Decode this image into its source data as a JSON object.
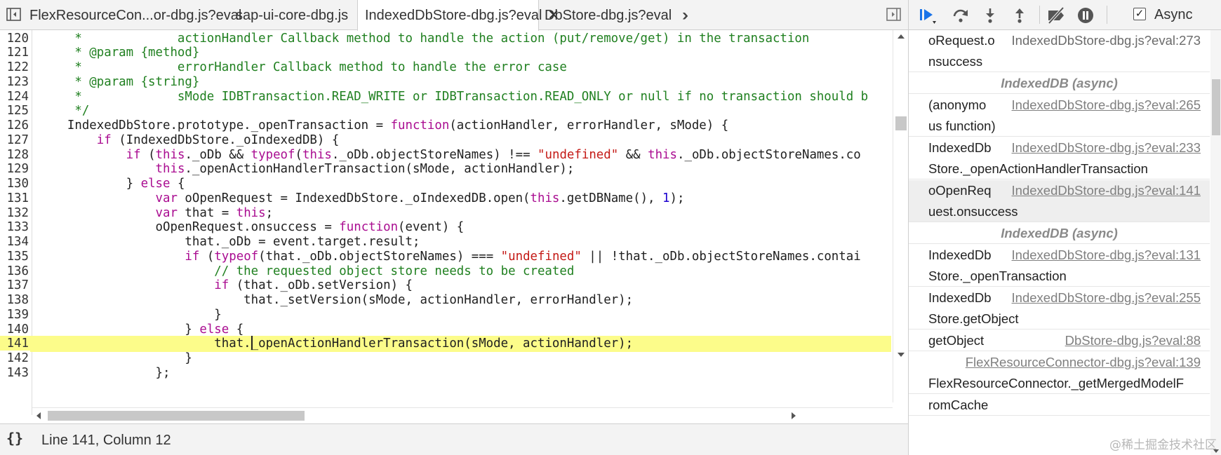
{
  "tabs": [
    {
      "label": "FlexResourceCon...or-dbg.js?eval"
    },
    {
      "label": "sap-ui-core-dbg.js"
    },
    {
      "label": "IndexedDbStore-dbg.js?eval",
      "close": "✕"
    },
    {
      "label": "DbStore-dbg.js?eval"
    }
  ],
  "editor": {
    "lines": [
      {
        "n": "120",
        "code": [
          [
            "c",
            "     *             actionHandler Callback method to handle the action (put/remove/get) in the transaction"
          ]
        ]
      },
      {
        "n": "121",
        "code": [
          [
            "c",
            "     * @param {method}"
          ]
        ]
      },
      {
        "n": "122",
        "code": [
          [
            "c",
            "     *             errorHandler Callback method to handle the error case"
          ]
        ]
      },
      {
        "n": "123",
        "code": [
          [
            "c",
            "     * @param {string}"
          ]
        ]
      },
      {
        "n": "124",
        "code": [
          [
            "c",
            "     *             sMode IDBTransaction.READ_WRITE or IDBTransaction.READ_ONLY or null if no transaction should b"
          ]
        ]
      },
      {
        "n": "125",
        "code": [
          [
            "c",
            "     */"
          ]
        ]
      },
      {
        "n": "126",
        "code": [
          [
            "p",
            "    IndexedDbStore.prototype._openTransaction = "
          ],
          [
            "k",
            "function"
          ],
          [
            "p",
            "(actionHandler, errorHandler, sMode) {"
          ]
        ]
      },
      {
        "n": "127",
        "code": [
          [
            "p",
            "        "
          ],
          [
            "k",
            "if"
          ],
          [
            "p",
            " (IndexedDbStore._oIndexedDB) {"
          ]
        ]
      },
      {
        "n": "128",
        "code": [
          [
            "p",
            "            "
          ],
          [
            "k",
            "if"
          ],
          [
            "p",
            " ("
          ],
          [
            "k",
            "this"
          ],
          [
            "p",
            "._oDb && "
          ],
          [
            "k",
            "typeof"
          ],
          [
            "p",
            "("
          ],
          [
            "k",
            "this"
          ],
          [
            "p",
            "._oDb.objectStoreNames) !== "
          ],
          [
            "s",
            "\"undefined\""
          ],
          [
            "p",
            " && "
          ],
          [
            "k",
            "this"
          ],
          [
            "p",
            "._oDb.objectStoreNames.co"
          ]
        ]
      },
      {
        "n": "129",
        "code": [
          [
            "p",
            "                "
          ],
          [
            "k",
            "this"
          ],
          [
            "p",
            "._openActionHandlerTransaction(sMode, actionHandler);"
          ]
        ]
      },
      {
        "n": "130",
        "code": [
          [
            "p",
            "            } "
          ],
          [
            "k",
            "else"
          ],
          [
            "p",
            " {"
          ]
        ]
      },
      {
        "n": "131",
        "code": [
          [
            "p",
            "                "
          ],
          [
            "k",
            "var"
          ],
          [
            "p",
            " oOpenRequest = IndexedDbStore._oIndexedDB.open("
          ],
          [
            "k",
            "this"
          ],
          [
            "p",
            ".getDBName(), "
          ],
          [
            "n",
            "1"
          ],
          [
            "p",
            ");"
          ]
        ]
      },
      {
        "n": "132",
        "code": [
          [
            "p",
            "                "
          ],
          [
            "k",
            "var"
          ],
          [
            "p",
            " that = "
          ],
          [
            "k",
            "this"
          ],
          [
            "p",
            ";"
          ]
        ]
      },
      {
        "n": "133",
        "code": [
          [
            "p",
            "                oOpenRequest.onsuccess = "
          ],
          [
            "k",
            "function"
          ],
          [
            "p",
            "(event) {"
          ]
        ]
      },
      {
        "n": "134",
        "code": [
          [
            "p",
            "                    that._oDb = event.target.result;"
          ]
        ]
      },
      {
        "n": "135",
        "code": [
          [
            "p",
            "                    "
          ],
          [
            "k",
            "if"
          ],
          [
            "p",
            " ("
          ],
          [
            "k",
            "typeof"
          ],
          [
            "p",
            "(that._oDb.objectStoreNames) === "
          ],
          [
            "s",
            "\"undefined\""
          ],
          [
            "p",
            " || !that._oDb.objectStoreNames.contai"
          ]
        ]
      },
      {
        "n": "136",
        "code": [
          [
            "c",
            "                        // the requested object store needs to be created"
          ]
        ]
      },
      {
        "n": "137",
        "code": [
          [
            "p",
            "                        "
          ],
          [
            "k",
            "if"
          ],
          [
            "p",
            " (that._oDb.setVersion) {"
          ]
        ]
      },
      {
        "n": "138",
        "code": [
          [
            "p",
            "                            that._setVersion(sMode, actionHandler, errorHandler);"
          ]
        ]
      },
      {
        "n": "139",
        "code": [
          [
            "p",
            "                        }"
          ]
        ]
      },
      {
        "n": "140",
        "code": [
          [
            "p",
            "                    } "
          ],
          [
            "k",
            "else"
          ],
          [
            "p",
            " {"
          ]
        ]
      },
      {
        "n": "141",
        "code": [
          [
            "p",
            "                        that."
          ],
          [
            "caret",
            ""
          ],
          [
            "p",
            "_openActionHandlerTransaction(sMode, actionHandler);"
          ]
        ],
        "exec": true
      },
      {
        "n": "142",
        "code": [
          [
            "p",
            "                    }"
          ]
        ]
      },
      {
        "n": "143",
        "code": [
          [
            "p",
            "                };"
          ]
        ]
      }
    ]
  },
  "status": {
    "position": "Line 141, Column 12",
    "format_label": "{}"
  },
  "debugger": {
    "async_label": "Async",
    "async_checked": true,
    "frames": [
      {
        "kind": "frame",
        "fn": "oRequest.o",
        "fn2": "nsuccess",
        "loc": "IndexedDbStore-dbg.js?eval:273",
        "loc_style": "plain"
      },
      {
        "kind": "async",
        "label": "IndexedDB (async)"
      },
      {
        "kind": "frame",
        "fn": "(anonymo",
        "fn2": "us function)",
        "loc": "IndexedDbStore-dbg.js?eval:265"
      },
      {
        "kind": "frame",
        "fn": "IndexedDb",
        "fn2": "Store._openActionHandlerTransaction",
        "loc": "IndexedDbStore-dbg.js?eval:233"
      },
      {
        "kind": "frame",
        "fn": "oOpenReq",
        "fn2": "uest.onsuccess",
        "loc": "IndexedDbStore-dbg.js?eval:141",
        "selected": true
      },
      {
        "kind": "async",
        "label": "IndexedDB (async)"
      },
      {
        "kind": "frame",
        "fn": "IndexedDb",
        "fn2": "Store._openTransaction",
        "loc": "IndexedDbStore-dbg.js?eval:131"
      },
      {
        "kind": "frame",
        "fn": "IndexedDb",
        "fn2": "Store.getObject",
        "loc": "IndexedDbStore-dbg.js?eval:255"
      },
      {
        "kind": "frame1",
        "fn": "getObject",
        "loc": "DbStore-dbg.js?eval:88"
      },
      {
        "kind": "frame",
        "fn": "",
        "fn2": "FlexResourceConnector._getMergedModelF",
        "loc": "FlexResourceConnector-dbg.js?eval:139"
      },
      {
        "kind": "tail",
        "fn": "romCache"
      }
    ]
  },
  "watermark": "@稀土掘金技术社区"
}
